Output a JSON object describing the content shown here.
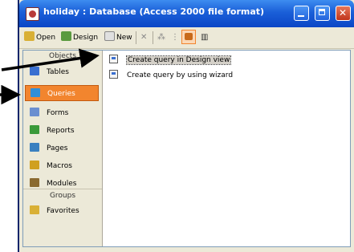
{
  "window": {
    "title": "holiday : Database (Access 2000 file format)"
  },
  "toolbar": {
    "open_label": "Open",
    "design_label": "Design",
    "new_label": "New"
  },
  "objects_bar": {
    "header": "Objects",
    "items": [
      {
        "label": "Tables",
        "icon": "table-icon",
        "color": "#3a6fd0"
      },
      {
        "label": "Queries",
        "icon": "query-icon",
        "color": "#2f8fd8"
      },
      {
        "label": "Forms",
        "icon": "form-icon",
        "color": "#6b8fd0"
      },
      {
        "label": "Reports",
        "icon": "report-icon",
        "color": "#3a9a3a"
      },
      {
        "label": "Pages",
        "icon": "page-icon",
        "color": "#3a80c0"
      },
      {
        "label": "Macros",
        "icon": "macro-icon",
        "color": "#d0a020"
      },
      {
        "label": "Modules",
        "icon": "module-icon",
        "color": "#8a6a30"
      }
    ],
    "selected": "Queries",
    "groups_header": "Groups",
    "groups": [
      {
        "label": "Favorites",
        "icon": "favorites-folder-icon",
        "color": "#d9b036"
      }
    ]
  },
  "list": {
    "items": [
      {
        "label": "Create query in Design view"
      },
      {
        "label": "Create query by using wizard"
      }
    ],
    "selected": "Create query in Design view"
  },
  "annotations": {
    "arrow_color": "#000000"
  }
}
